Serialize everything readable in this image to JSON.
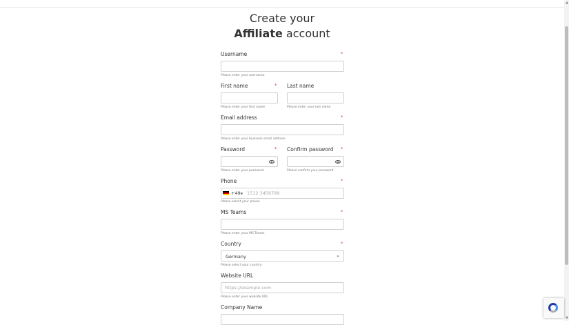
{
  "header": {
    "title_line1": "Create your",
    "title_bold": "Affiliate",
    "title_rest": "account"
  },
  "form": {
    "username": {
      "label": "Username",
      "required": "*",
      "value": "",
      "help": "Please enter your username"
    },
    "first_name": {
      "label": "First name",
      "required": "*",
      "value": "",
      "help": "Please enter your first name"
    },
    "last_name": {
      "label": "Last name",
      "value": "",
      "help": "Please enter your last name"
    },
    "email": {
      "label": "Email address",
      "required": "*",
      "value": "",
      "help": "Please enter your business email address"
    },
    "password": {
      "label": "Password",
      "required": "*",
      "value": "",
      "help": "Please enter your password"
    },
    "confirm_password": {
      "label": "Confirm password",
      "required": "*",
      "value": "",
      "help": "Please confirm your password"
    },
    "phone": {
      "label": "Phone",
      "required": "*",
      "country_code": "+49",
      "placeholder": "1512 3456789",
      "value": "",
      "help": "Please select your phone"
    },
    "ms_teams": {
      "label": "MS Teams",
      "required": "*",
      "value": "",
      "help": "Please enter your MS Teams"
    },
    "country": {
      "label": "Country",
      "required": "*",
      "selected": "Germany",
      "help": "Please select your country"
    },
    "website": {
      "label": "Website URL",
      "placeholder": "https://example.com",
      "value": "",
      "help": "Please enter your website URL"
    },
    "company": {
      "label": "Company Name",
      "value": ""
    }
  },
  "icons": {
    "eye": "eye-icon",
    "flag": "germany-flag-icon",
    "select_chevron": "chevron-down-icon",
    "recaptcha": "recaptcha-icon"
  },
  "colors": {
    "required": "#e53935",
    "border": "#cfcfcf",
    "text": "#333333"
  }
}
